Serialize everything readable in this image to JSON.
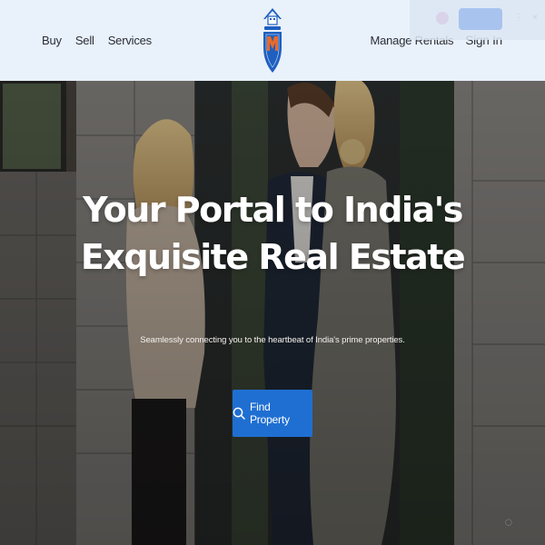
{
  "nav": {
    "left": [
      {
        "label": "Buy"
      },
      {
        "label": "Sell"
      },
      {
        "label": "Services"
      }
    ],
    "right": {
      "manage_rentals": "Manage Rentals",
      "sign_in": "Sign In"
    }
  },
  "logo": {
    "icon": "house-shield-logo",
    "colors": {
      "primary": "#1f5fbf",
      "accent": "#e86a2a"
    }
  },
  "hero": {
    "title_line1": "Your Portal to India's",
    "title_line2": "Exquisite Real Estate",
    "subtitle": "Seamlessly connecting you to the heartbeat of India's prime properties.",
    "cta": {
      "label": "Find Property",
      "icon": "search-icon"
    }
  },
  "colors": {
    "header_bg": "#e9f1fb",
    "cta_bg": "#1f6fd2",
    "text_dark": "#2b2f36"
  }
}
